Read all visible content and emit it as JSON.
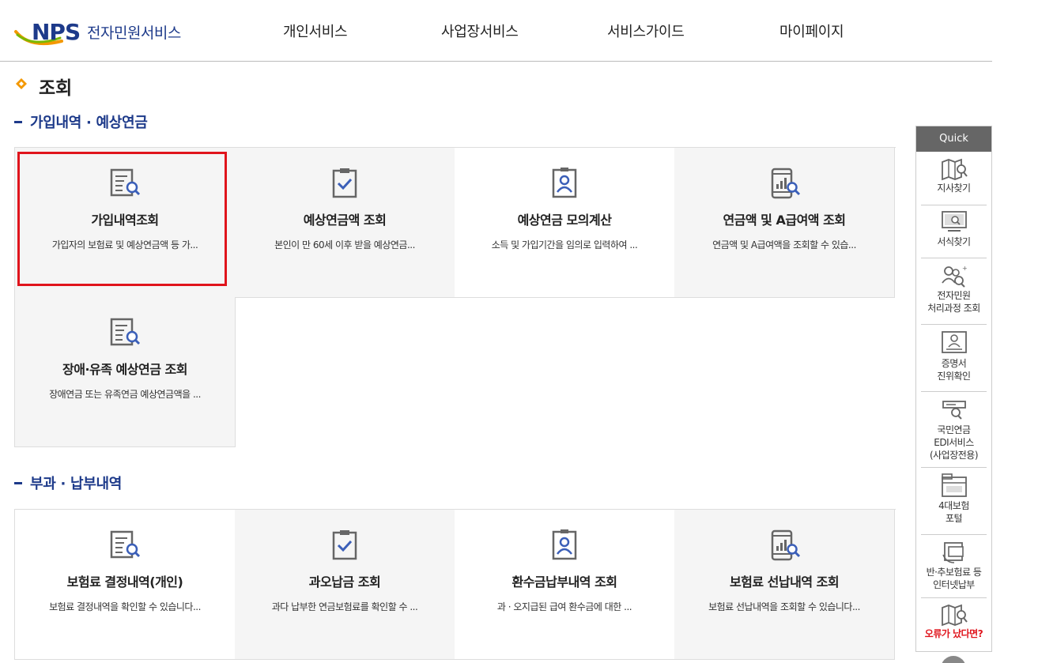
{
  "header": {
    "logo_brand": "NPS",
    "logo_title": "전자민원서비스",
    "nav": [
      "개인서비스",
      "사업장서비스",
      "서비스가이드",
      "마이페이지"
    ]
  },
  "page": {
    "title": "조회"
  },
  "sections": [
    {
      "title": "가입내역 · 예상연금",
      "cards": [
        {
          "title": "가입내역조회",
          "desc": "가입자의 보험료 및 예상연금액 등 가...",
          "icon": "document-search-icon"
        },
        {
          "title": "예상연금액 조회",
          "desc": "본인이 만 60세 이후 받을 예상연금...",
          "icon": "clipboard-check-icon"
        },
        {
          "title": "예상연금 모의계산",
          "desc": "소득 및 가입기간을 임의로 입력하여 ...",
          "icon": "person-badge-icon"
        },
        {
          "title": "연금액 및 A급여액 조회",
          "desc": "연금액 및 A급여액을 조회할 수 있습...",
          "icon": "phone-chart-search-icon"
        },
        {
          "title": "장애·유족 예상연금 조회",
          "desc": "장애연금 또는 유족연금 예상연금액을 ...",
          "icon": "document-search-icon"
        }
      ]
    },
    {
      "title": "부과 · 납부내역",
      "cards": [
        {
          "title": "보험료 결정내역(개인)",
          "desc": "보험료 결정내역을 확인할 수 있습니다...",
          "icon": "document-search-icon"
        },
        {
          "title": "과오납금 조회",
          "desc": "과다 납부한 연금보험료를 확인할 수 ...",
          "icon": "clipboard-check-icon"
        },
        {
          "title": "환수금납부내역 조회",
          "desc": "과 · 오지급된 급여 환수금에 대한 ...",
          "icon": "person-badge-icon"
        },
        {
          "title": "보험료 선납내역 조회",
          "desc": "보험료 선납내역을 조회할 수 있습니다...",
          "icon": "phone-chart-search-icon"
        }
      ]
    }
  ],
  "quick": {
    "header": "Quick",
    "items": [
      {
        "label1": "지사찾기",
        "label2": "",
        "label3": "",
        "icon": "map-search-icon"
      },
      {
        "label1": "서식찾기",
        "label2": "",
        "label3": "",
        "icon": "monitor-search-icon"
      },
      {
        "label1": "전자민원",
        "label2": "처리과정 조회",
        "label3": "",
        "icon": "people-search-icon"
      },
      {
        "label1": "증명서",
        "label2": "진위확인",
        "label3": "",
        "icon": "certificate-icon"
      },
      {
        "label1": "국민연금",
        "label2": "EDI서비스",
        "label3": "(사업장전용)",
        "icon": "edi-icon"
      },
      {
        "label1": "4대보험",
        "label2": "포털",
        "label3": "",
        "icon": "folder-portal-icon"
      },
      {
        "label1": "반·추보험료 등",
        "label2": "인터넷납부",
        "label3": "",
        "icon": "card-payment-icon"
      },
      {
        "label1": "오류가 났다면?",
        "label2": "",
        "label3": "",
        "icon": "map-search-icon"
      }
    ]
  },
  "colors": {
    "brand_blue": "#1d3a8a",
    "logo_green": "#7ab800",
    "logo_orange": "#f39800",
    "highlight_red": "#e0141c",
    "icon_blue": "#3b5fb8",
    "icon_gray": "#666666"
  }
}
